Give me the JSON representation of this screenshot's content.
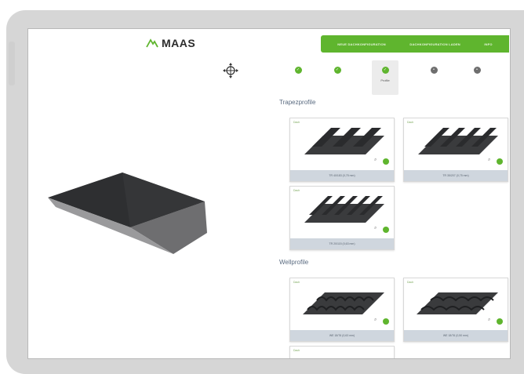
{
  "header": {
    "logo_text": "MAAS",
    "nav": [
      "NEUE DACHKONFIGURATION",
      "DACHKONFIGURATION LADEN",
      "INFO"
    ]
  },
  "steps": [
    {
      "label": "",
      "state": "done"
    },
    {
      "label": "",
      "state": "done"
    },
    {
      "label": "Profile",
      "state": "active"
    },
    {
      "label": "",
      "state": "todo"
    },
    {
      "label": "",
      "state": "todo"
    }
  ],
  "sections": {
    "trapez": {
      "title": "Trapezprofile",
      "cards": [
        {
          "tag": "Dach",
          "caption": "TR 40/183 (0,75 mm)"
        },
        {
          "tag": "Dach",
          "caption": "TR 35/207 (0,75 mm)"
        },
        {
          "tag": "Dach",
          "caption": "TR 20/115 (0,63 mm)"
        }
      ]
    },
    "well": {
      "title": "Wellprofile",
      "cards": [
        {
          "tag": "Dach",
          "caption": "WE 18/76 (0,63 mm)"
        },
        {
          "tag": "Dach",
          "caption": "WE 18/76 (0,50 mm)"
        },
        {
          "tag": "Dach",
          "caption": ""
        }
      ]
    }
  },
  "colors": {
    "accent": "#5fb52e",
    "section_title": "#5a6b80",
    "card_footer": "#cfd6de",
    "frame": "#d6d6d6"
  },
  "icons": {
    "viewer_control": "rotate-drag-icon",
    "step_done": "checkmark-icon",
    "card_zoom": "magnifier-icon",
    "card_select": "green-dot-icon"
  }
}
